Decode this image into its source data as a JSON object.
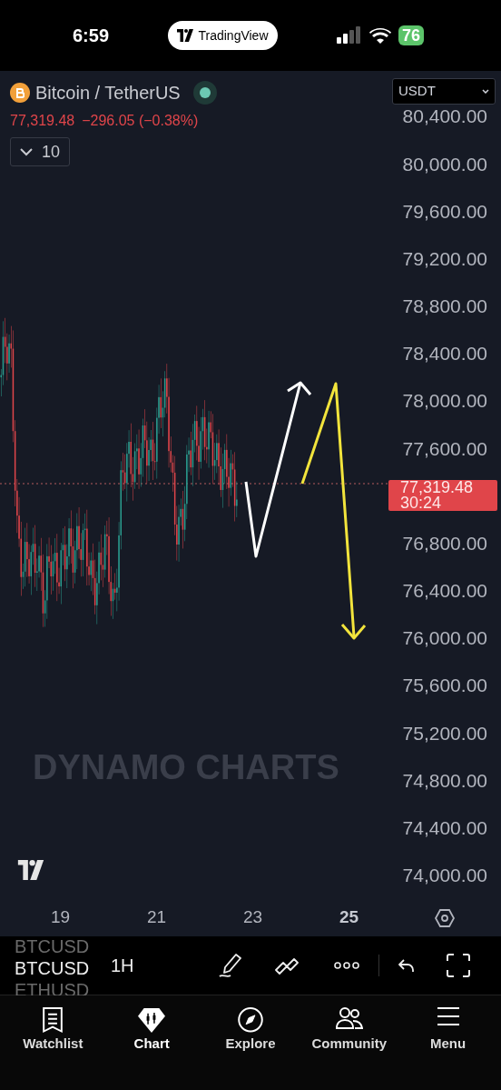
{
  "status_bar": {
    "time": "6:59",
    "app_pill": "TradingView",
    "battery": "76"
  },
  "symbol_header": {
    "name": "Bitcoin / TetherUS",
    "price": "77,319.48",
    "change": "−296.05 (−0.38%)",
    "indicators_button": "10"
  },
  "currency_select": {
    "value": "USDT"
  },
  "price_axis": {
    "upper_labels": [
      "80,400.00",
      "80,000.00",
      "79,600.00",
      "79,200.00",
      "78,800.00",
      "78,400.00",
      "78,000.00",
      "77,600.00"
    ],
    "last_price": {
      "price": "77,319.48",
      "countdown": "30:24"
    },
    "lower_labels": [
      "76,800.00",
      "76,400.00",
      "76,000.00",
      "75,600.00",
      "75,200.00",
      "74,800.00",
      "74,400.00",
      "74,000.00"
    ]
  },
  "chart_watermark": "DYNAMO CHARTS",
  "time_axis": {
    "labels": [
      {
        "text": "19",
        "bold": false
      },
      {
        "text": "21",
        "bold": false
      },
      {
        "text": "23",
        "bold": false
      },
      {
        "text": "25",
        "bold": true
      }
    ]
  },
  "toolbar": {
    "symbol_picker": {
      "previous": "BTCUSD",
      "current": "BTCUSD",
      "next": "ETHUSD"
    },
    "interval": "1H"
  },
  "bottom_nav": [
    {
      "label": "Watchlist",
      "selected": false
    },
    {
      "label": "Chart",
      "selected": true
    },
    {
      "label": "Explore",
      "selected": false
    },
    {
      "label": "Community",
      "selected": false
    },
    {
      "label": "Menu",
      "selected": false
    }
  ]
}
